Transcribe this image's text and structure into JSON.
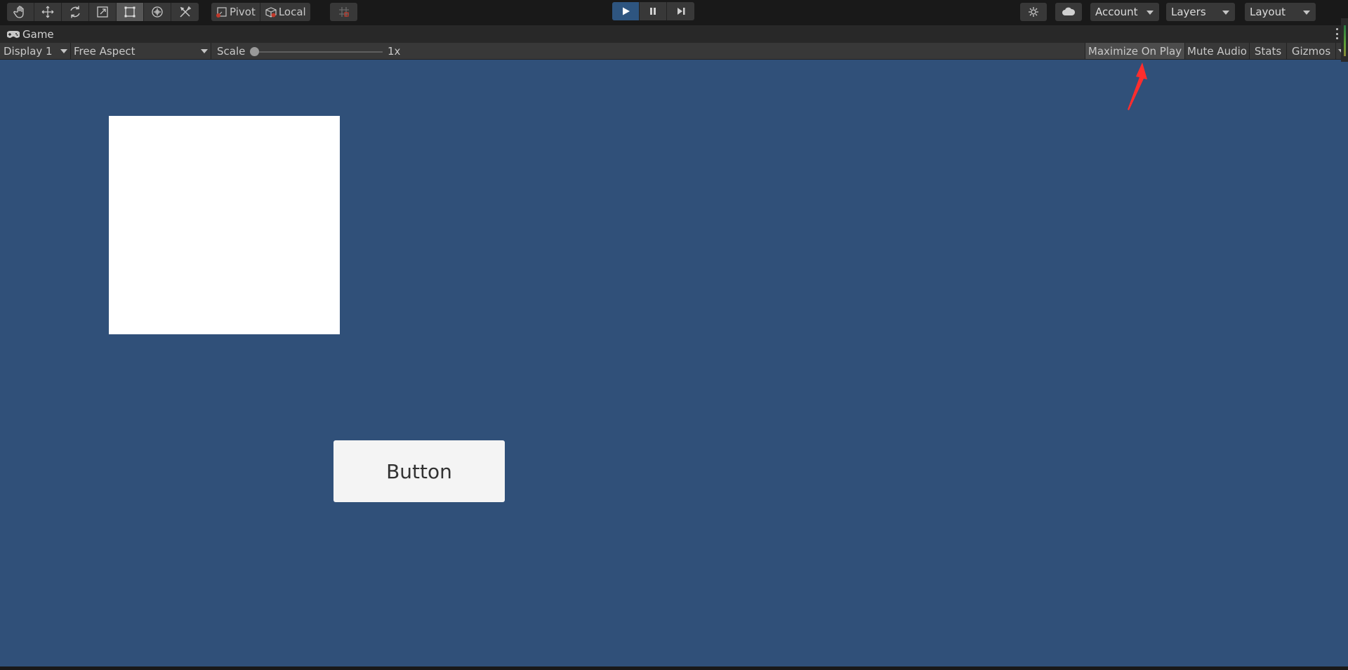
{
  "toolbar": {
    "tools": [
      {
        "name": "hand-tool-icon"
      },
      {
        "name": "move-tool-icon"
      },
      {
        "name": "rotate-tool-icon"
      },
      {
        "name": "scale-tool-icon"
      },
      {
        "name": "rect-tool-icon",
        "active": true
      },
      {
        "name": "transform-tool-icon"
      },
      {
        "name": "custom-tools-icon"
      }
    ],
    "pivot_label": "Pivot",
    "local_label": "Local",
    "grid_snap_icon": "grid-snap-icon",
    "play_icon": "play-icon",
    "pause_icon": "pause-icon",
    "step_icon": "step-icon",
    "services_icon": "services-icon",
    "cloud_icon": "cloud-icon",
    "account_label": "Account",
    "layers_label": "Layers",
    "layout_label": "Layout"
  },
  "game_tab": {
    "label": "Game",
    "icon": "gamepad-icon"
  },
  "game_toolbar": {
    "display": "Display 1",
    "aspect": "Free Aspect",
    "scale_label": "Scale",
    "scale_value": "1x",
    "maximize_on_play": "Maximize On Play",
    "mute_audio": "Mute Audio",
    "stats": "Stats",
    "gizmos": "Gizmos"
  },
  "game_view": {
    "background_color": "#305079",
    "button_label": "Button"
  },
  "colors": {
    "toolbar_bg": "#191919",
    "button_bg": "#383838",
    "play_active": "#2e5580",
    "annotation_arrow": "#ff2d2d"
  }
}
